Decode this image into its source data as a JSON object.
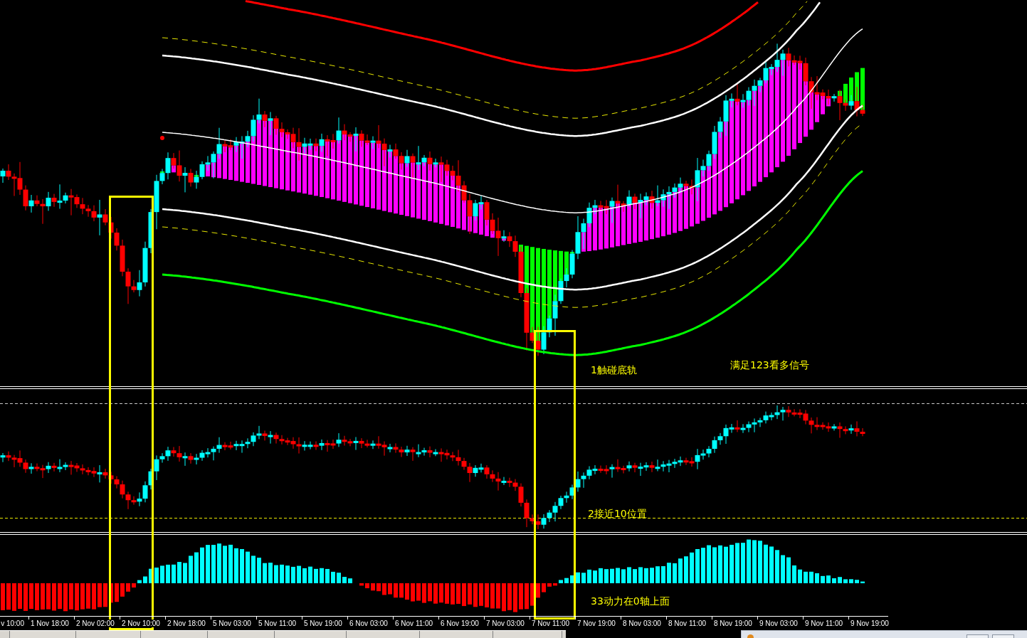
{
  "main_panel": {
    "notes": [
      "1触碰底轨",
      "满足123看多信号"
    ]
  },
  "oscillator_panel": {
    "notes": [
      "2接近10位置"
    ]
  },
  "momentum_panel": {
    "notes": [
      "33动力在0轴上面"
    ]
  },
  "time_axis": {
    "labels": [
      "v 10:00",
      "1 Nov 18:00",
      "2 Nov 02:00",
      "2 Nov 10:00",
      "2 Nov 18:00",
      "5 Nov 03:00",
      "5 Nov 11:00",
      "5 Nov 19:00",
      "6 Nov 03:00",
      "6 Nov 11:00",
      "6 Nov 19:00",
      "7 Nov 03:00",
      "7 Nov 11:00",
      "7 Nov 19:00",
      "8 Nov 03:00",
      "8 Nov 11:00",
      "8 Nov 19:00",
      "9 Nov 03:00",
      "9 Nov 11:00",
      "9 Nov 19:00"
    ]
  }
}
